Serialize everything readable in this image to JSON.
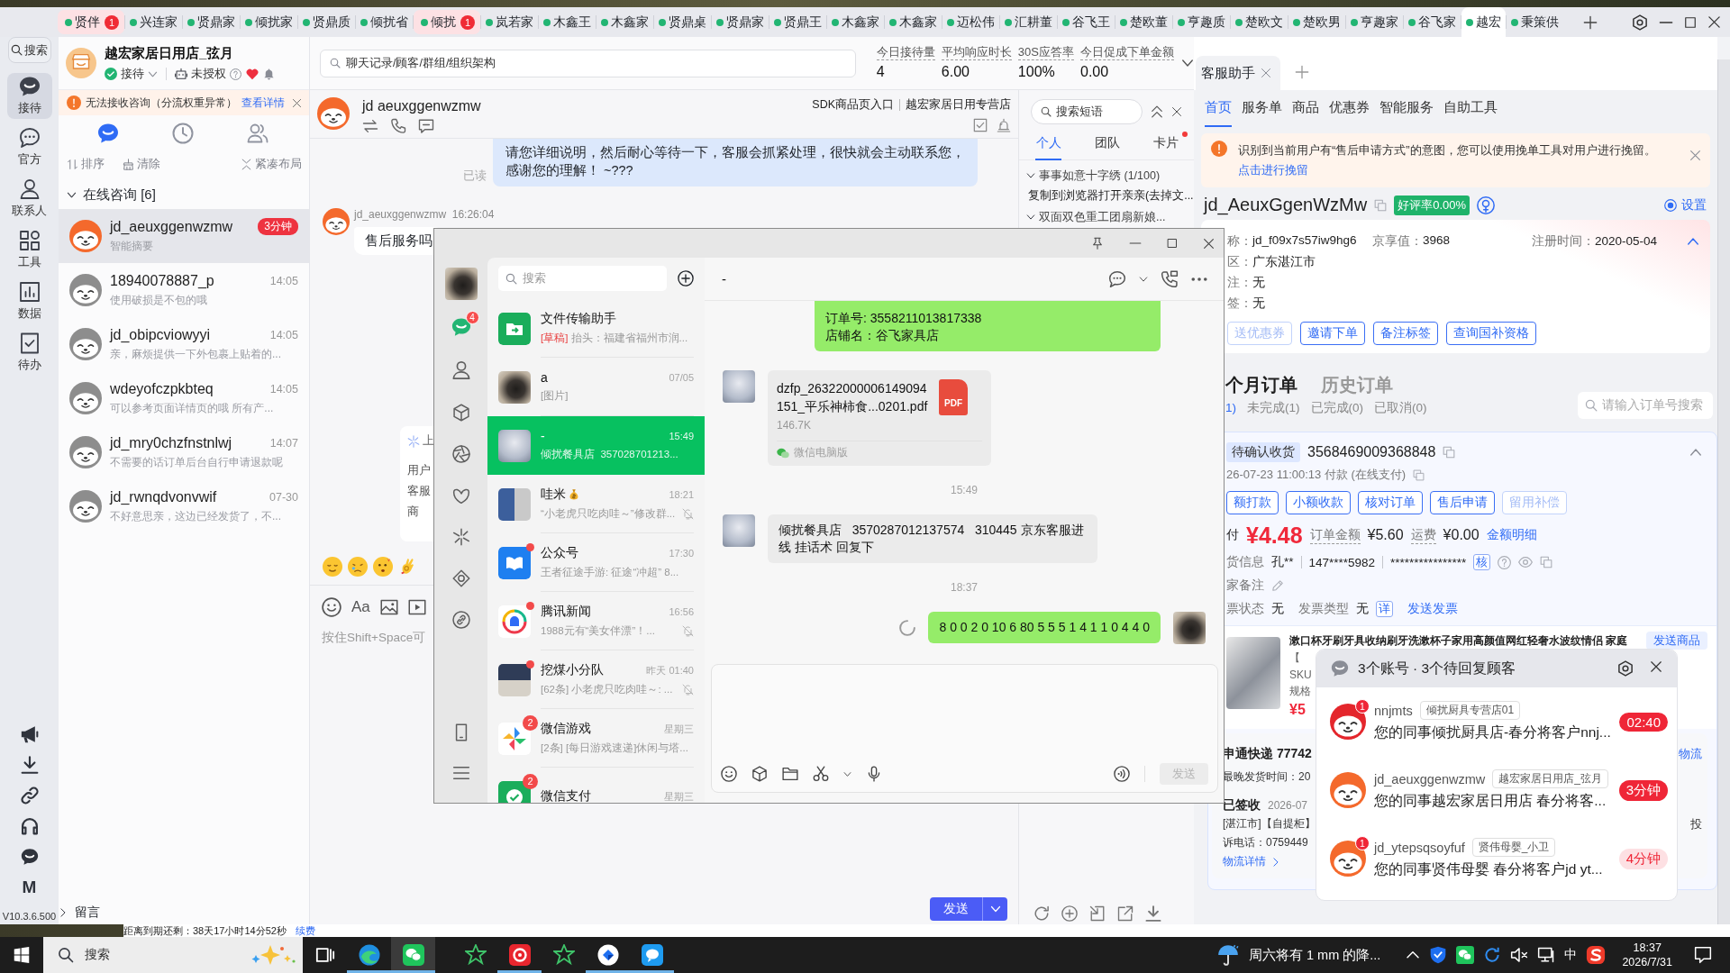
{
  "app_tabs": [
    {
      "label": "贤伴",
      "badge": "1",
      "selected": false
    },
    {
      "label": "兴连家",
      "selected": false
    },
    {
      "label": "贤鼎家",
      "selected": false
    },
    {
      "label": "倾扰家",
      "selected": false
    },
    {
      "label": "贤鼎质",
      "selected": false
    },
    {
      "label": "倾扰省",
      "selected": false
    },
    {
      "label": "倾扰",
      "badge": "1",
      "selected": false
    },
    {
      "label": "岚若家",
      "selected": false
    },
    {
      "label": "木鑫王",
      "selected": false
    },
    {
      "label": "木鑫家",
      "selected": false
    },
    {
      "label": "贤鼎桌",
      "selected": false
    },
    {
      "label": "贤鼎家",
      "selected": false
    },
    {
      "label": "贤鼎王",
      "selected": false
    },
    {
      "label": "木鑫家",
      "selected": false
    },
    {
      "label": "木鑫家",
      "selected": false
    },
    {
      "label": "迈松伟",
      "selected": false
    },
    {
      "label": "汇耕董",
      "selected": false
    },
    {
      "label": "谷飞王",
      "selected": false
    },
    {
      "label": "楚欧董",
      "selected": false
    },
    {
      "label": "亨趣质",
      "selected": false
    },
    {
      "label": "楚欧文",
      "selected": false
    },
    {
      "label": "楚欧男",
      "selected": false
    },
    {
      "label": "亨趣家",
      "selected": false
    },
    {
      "label": "谷飞家",
      "selected": false
    },
    {
      "label": "越宏",
      "selected": true
    },
    {
      "label": "秉策供",
      "selected": false
    }
  ],
  "rail": {
    "search": "搜索",
    "items": [
      {
        "label": "接待",
        "selected": true
      },
      {
        "label": "官方",
        "selected": false
      },
      {
        "label": "联系人",
        "selected": false
      },
      {
        "label": "工具",
        "selected": false
      },
      {
        "label": "数据",
        "selected": false
      },
      {
        "label": "待办",
        "selected": false
      }
    ],
    "mark": "M",
    "version": "V10.3.6.500"
  },
  "shop": {
    "name": "越宏家居日用店_弦月",
    "status": "接待",
    "auth": "未授权"
  },
  "alert": {
    "text": "无法接收咨询（分流权重异常）",
    "link": "查看详情"
  },
  "list_views": [
    {
      "selected": true
    },
    {
      "selected": false
    },
    {
      "selected": false
    }
  ],
  "list_actions": [
    "排序",
    "清除",
    "紧凑布局"
  ],
  "consult_group": {
    "label": "在线咨询 [6]",
    "expanded": true
  },
  "conversations": [
    {
      "name": "jd_aeuxggenwzmw",
      "preview": "智能摘要",
      "time": "3分钟",
      "overdue": true,
      "active": true,
      "selected": true
    },
    {
      "name": "18940078887_p",
      "preview": "使用破损是不包的哦",
      "time": "14:05",
      "overdue": false,
      "active": false,
      "selected": false
    },
    {
      "name": "jd_obipcviowyyi",
      "preview": "亲，麻烦提供一下外包裹上贴着的...",
      "time": "14:05",
      "overdue": false,
      "active": false,
      "selected": false
    },
    {
      "name": "wdeyofczpkbteq",
      "preview": "可以参考页面详情页的哦 所有产...",
      "time": "14:05",
      "overdue": false,
      "active": false,
      "selected": false
    },
    {
      "name": "jd_mry0chzfnstnlwj",
      "preview": "不需要的话订单后台自行申请退款呢",
      "time": "14:07",
      "overdue": false,
      "active": false,
      "selected": false
    },
    {
      "name": "jd_rwnqdvonvwif",
      "preview": "不好意思亲，这边已经发货了，不...",
      "time": "07-30",
      "overdue": false,
      "active": false,
      "selected": false
    }
  ],
  "leave_group": {
    "label": "留言",
    "expanded": false
  },
  "topbar": {
    "search_placeholder": "聊天记录/顾客/群组/组织架构",
    "stats": [
      {
        "label": "今日接待量",
        "value": "4"
      },
      {
        "label": "平均响应时长",
        "value": "6.00"
      },
      {
        "label": "30S应答率",
        "value": "100%"
      },
      {
        "label": "今日促成下单金额",
        "value": "0.00"
      }
    ]
  },
  "chat": {
    "customer": "jd aeuxggenwzmw",
    "source": "SDK商品页入口",
    "store": "越宏家居日用专营店",
    "messages": [
      {
        "kind": "agent",
        "text": "请您详细说明，然后耐心等待一下，客服会抓紧处理，很快就会主动联系您，感谢您的理解！ ~???",
        "status": "已读"
      },
      {
        "kind": "customer",
        "sender": "jd_aeuxggenwzmw",
        "time": "16:26:04",
        "text": "售后服务吗"
      }
    ],
    "card": {
      "title": "上",
      "lines": [
        "用户",
        "客服",
        "商"
      ]
    },
    "format_label": "Aa",
    "input_placeholder": "按住Shift+Space可",
    "send": "发送"
  },
  "phrases": {
    "search_placeholder": "搜索短语",
    "tabs": [
      {
        "label": "个人",
        "selected": true,
        "dot": false
      },
      {
        "label": "团队",
        "selected": false,
        "dot": false
      },
      {
        "label": "卡片",
        "selected": false,
        "dot": true
      }
    ],
    "groups": [
      {
        "label": "事事如意十字绣 (1/100)",
        "expanded": true,
        "items": [
          "复制到浏览器打开亲亲(去掉文..."
        ]
      },
      {
        "label": "双面双色重工团扇新娘...",
        "expanded": true
      }
    ]
  },
  "assistant": {
    "tab": "客服助手",
    "nav": [
      {
        "label": "首页",
        "selected": true
      },
      {
        "label": "服务单",
        "selected": false
      },
      {
        "label": "商品",
        "selected": false
      },
      {
        "label": "优惠券",
        "selected": false
      },
      {
        "label": "智能服务",
        "selected": false
      },
      {
        "label": "自助工具",
        "selected": false
      }
    ],
    "notice": {
      "text": "识别到当前用户有“售后申请方式”的意图，您可以使用挽单工具对用户进行挽留。",
      "link": "点击进行挽留"
    },
    "customer": {
      "name": "jd_AeuxGgenWzMw",
      "rating": "好评率0.00%",
      "setting": "设置",
      "setting_on": true
    },
    "profile": [
      {
        "label": "称：",
        "value": "jd_f09x7s57iw9hg6"
      },
      {
        "label": "区：",
        "value": "广东湛江市"
      },
      {
        "label": "注：",
        "value": "无"
      },
      {
        "label": "签：",
        "value": "无"
      }
    ],
    "jd_score": {
      "label": "京享值：",
      "value": "3968"
    },
    "registered": {
      "label": "注册时间：",
      "value": "2020-05-04"
    },
    "profile_actions": [
      {
        "label": "送优惠券",
        "disabled": true
      },
      {
        "label": "邀请下单",
        "disabled": false
      },
      {
        "label": "备注标签",
        "disabled": false
      },
      {
        "label": "查询国补资格",
        "disabled": false
      }
    ],
    "order_tabs": [
      {
        "label": "个月订单",
        "selected": true
      },
      {
        "label": "历史订单",
        "selected": false
      }
    ],
    "order_filters": [
      {
        "label": "1)",
        "selected": true
      },
      {
        "label": "未完成(1)",
        "selected": false
      },
      {
        "label": "已完成(0)",
        "selected": false
      },
      {
        "label": "已取消(0)",
        "selected": false
      }
    ],
    "order_search": "请输入订单号搜索",
    "order": {
      "status": "待确认收货",
      "id": "3568469009368848",
      "paid": "26-07-23 11:00:13 付款 (在线支付)",
      "actions": [
        {
          "label": "额打款",
          "disabled": false
        },
        {
          "label": "小额收款",
          "disabled": false
        },
        {
          "label": "核对订单",
          "disabled": false
        },
        {
          "label": "售后申请",
          "disabled": false
        },
        {
          "label": "留用补偿",
          "disabled": true
        }
      ],
      "pay_label": "付",
      "pay": "¥4.48",
      "amount_label": "订单金额",
      "amount": "¥5.60",
      "freight_label": "运费",
      "freight": "¥0.00",
      "amount_link": "金额明细",
      "receiver_label": "货信息",
      "receiver": "孔**",
      "phone": "147****5982",
      "address": "****************",
      "verify": "核",
      "note_label": "家备注",
      "invoice_label": "票状态",
      "invoice_status": "无",
      "invoice_type_label": "发票类型",
      "invoice_type": "无",
      "invoice_detail": "详",
      "invoice_link": "发送发票",
      "product": {
        "title": "漱口杯牙刷牙具收纳刷牙洗漱杯子家用高颜值网红轻奢水波纹情侣 家庭",
        "spec_prefix": "【",
        "sku": "SKU",
        "spec": "规格",
        "price": "¥5",
        "send": "发送商品"
      },
      "shipping": {
        "carrier": "申通快递 77742",
        "deadline": "最晚发货时间：20",
        "track": "物流",
        "state": "已签收",
        "date": "2026-07",
        "place": "[湛江市]【自提柜】",
        "complain": "投",
        "phone": "诉电话：0759449",
        "detail": "物流详情"
      }
    }
  },
  "status_strip": {
    "text": "距离到期还剩：38天17小时14分52秒",
    "link": "续费"
  },
  "wechat": {
    "nav_badge": "4",
    "search_placeholder": "搜索",
    "chats": [
      {
        "name": "文件传输助手",
        "draft": "[草稿]",
        "preview": "抬头：福建省福州市润...",
        "muted": false,
        "dot": false,
        "selected": false
      },
      {
        "name": "a",
        "preview": "[图片]",
        "time": "07/05",
        "muted": false,
        "dot": false,
        "selected": false
      },
      {
        "name": "-",
        "preview": "倾扰餐具店  357028701213...",
        "time": "15:49",
        "muted": false,
        "dot": false,
        "selected": true
      },
      {
        "name": "哇米",
        "emoji_badge": true,
        "preview": "“小老虎只吃肉哇～”修改群...",
        "time": "18:21",
        "muted": true,
        "dot": false,
        "selected": false
      },
      {
        "name": "公众号",
        "preview": "王者征途手游: 征途“冲超” 8...",
        "time": "17:30",
        "muted": false,
        "dot": true,
        "selected": false
      },
      {
        "name": "腾讯新闻",
        "preview": "1988元有“美女伴漂”！...",
        "time": "16:56",
        "muted": true,
        "dot": true,
        "selected": false
      },
      {
        "name": "挖煤小分队",
        "preview": "[62条] 小老虎只吃肉哇～: ...",
        "time": "昨天 01:40",
        "muted": true,
        "dot": true,
        "selected": false
      },
      {
        "name": "微信游戏",
        "preview": "[2条] [每日游戏速递]休闲与塔...",
        "time": "星期三",
        "muted": false,
        "dot": false,
        "badge": "2",
        "selected": false
      },
      {
        "name": "微信支付",
        "time": "星期三",
        "muted": false,
        "dot": false,
        "badge": "2",
        "selected": false
      }
    ],
    "contact": "-",
    "messages": [
      {
        "kind": "text",
        "mine": true,
        "clipped": true,
        "text": "订单号: 3558211013817338\n店铺名：谷飞家具店"
      },
      {
        "kind": "file",
        "mine": false,
        "name": "dzfp_26322000006149094151_平乐神柿食...0201.pdf",
        "size": "146.7K",
        "source": "微信电脑版",
        "file_type": "PDF"
      },
      {
        "kind": "time",
        "text": "15:49"
      },
      {
        "kind": "text",
        "mine": false,
        "text": "倾扰餐具店   3570287012137574   310445 京东客服进线 挂话术 回复下"
      },
      {
        "kind": "time",
        "text": "18:37"
      },
      {
        "kind": "text",
        "mine": true,
        "sending": true,
        "text": "8 0 0 2 0 10 6 80 5 5 5 1 4 1 1 0 4 4 0"
      }
    ],
    "send": "发送",
    "send_enabled": false
  },
  "popup": {
    "title": "3个账号 · 3个待回复顾客",
    "items": [
      {
        "name": "nnjmts",
        "store": "倾扰厨具专营店01",
        "message": "您的同事倾扰厨具店-春分将客户nnj...",
        "wait": "02:40",
        "urgent": true,
        "unread": "1",
        "color": "#e4262c"
      },
      {
        "name": "jd_aeuxggenwzmw",
        "store": "越宏家居日用店_弦月",
        "message": "您的同事越宏家居日用店 春分将客...",
        "wait": "3分钟",
        "urgent": true,
        "color": "#f4692c"
      },
      {
        "name": "jd_ytepsqsoyfuf",
        "store": "贤伟母婴_小卫",
        "message": "您的同事贤伟母婴 春分将客户jd yt...",
        "wait": "4分钟",
        "urgent": false,
        "unread": "1",
        "color": "#f4692c"
      }
    ]
  },
  "taskbar": {
    "search_placeholder": "搜索",
    "apps": [
      {
        "active": false,
        "running": false
      },
      {
        "active": false,
        "running": true
      },
      {
        "active": true,
        "running": true
      },
      {
        "active": false,
        "running": false
      },
      {
        "active": false,
        "running": true
      },
      {
        "active": false,
        "running": false
      },
      {
        "active": false,
        "running": true
      },
      {
        "active": false,
        "running": true
      }
    ],
    "weather": "周六将有 1 mm 的降...",
    "ime": "中",
    "time": "18:37",
    "date": "2026/7/31"
  }
}
